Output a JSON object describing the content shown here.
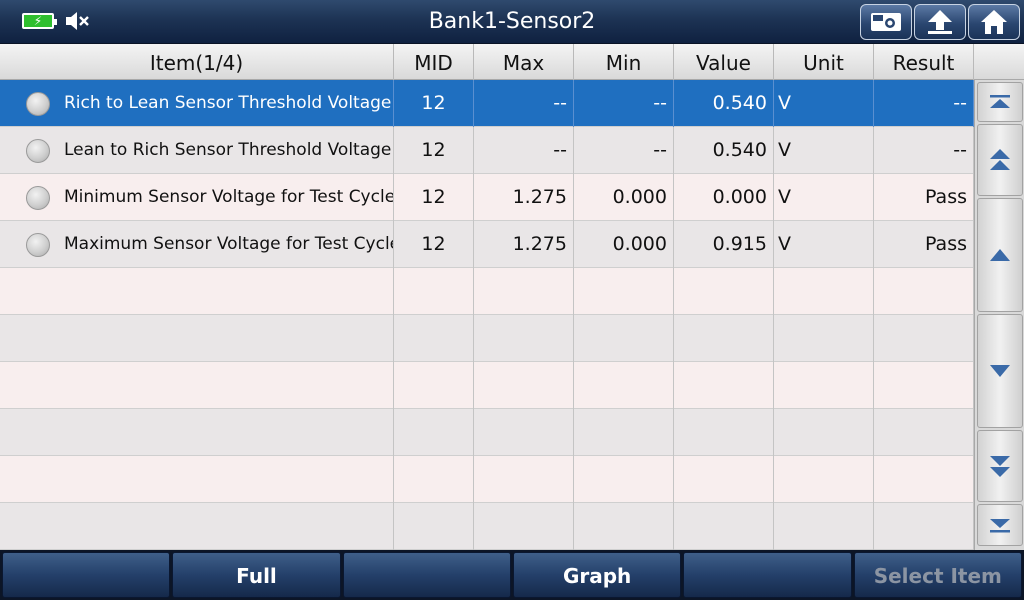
{
  "header": {
    "title": "Bank1-Sensor2",
    "buttons": [
      {
        "name": "screenshot-button",
        "icon": "camera-icon"
      },
      {
        "name": "back-button",
        "icon": "up-arrow-icon"
      },
      {
        "name": "home-button",
        "icon": "home-icon"
      }
    ]
  },
  "status": {
    "battery_icon": "battery-charging-icon",
    "sound_icon": "speaker-muted-icon"
  },
  "table": {
    "columns": [
      "Item(1/4)",
      "MID",
      "Max",
      "Min",
      "Value",
      "Unit",
      "Result"
    ],
    "rows": [
      {
        "item": "Rich to Lean Sensor Threshold Voltage",
        "mid": "12",
        "max": "--",
        "min": "--",
        "value": "0.540",
        "unit": "V",
        "result": "--",
        "selected": true
      },
      {
        "item": "Lean to Rich Sensor Threshold Voltage",
        "mid": "12",
        "max": "--",
        "min": "--",
        "value": "0.540",
        "unit": "V",
        "result": "--",
        "selected": false
      },
      {
        "item": "Minimum Sensor Voltage for Test Cycle",
        "mid": "12",
        "max": "1.275",
        "min": "0.000",
        "value": "0.000",
        "unit": "V",
        "result": "Pass",
        "selected": false
      },
      {
        "item": "Maximum Sensor Voltage for Test Cycle",
        "mid": "12",
        "max": "1.275",
        "min": "0.000",
        "value": "0.915",
        "unit": "V",
        "result": "Pass",
        "selected": false
      }
    ]
  },
  "colors": {
    "selected_row": "#1f6fc0",
    "titlebar": "#1d3354"
  },
  "footer": {
    "buttons": [
      {
        "label": "",
        "enabled": false
      },
      {
        "label": "Full",
        "enabled": true
      },
      {
        "label": "",
        "enabled": false
      },
      {
        "label": "Graph",
        "enabled": true
      },
      {
        "label": "",
        "enabled": false
      },
      {
        "label": "Select Item",
        "enabled": false
      }
    ]
  }
}
